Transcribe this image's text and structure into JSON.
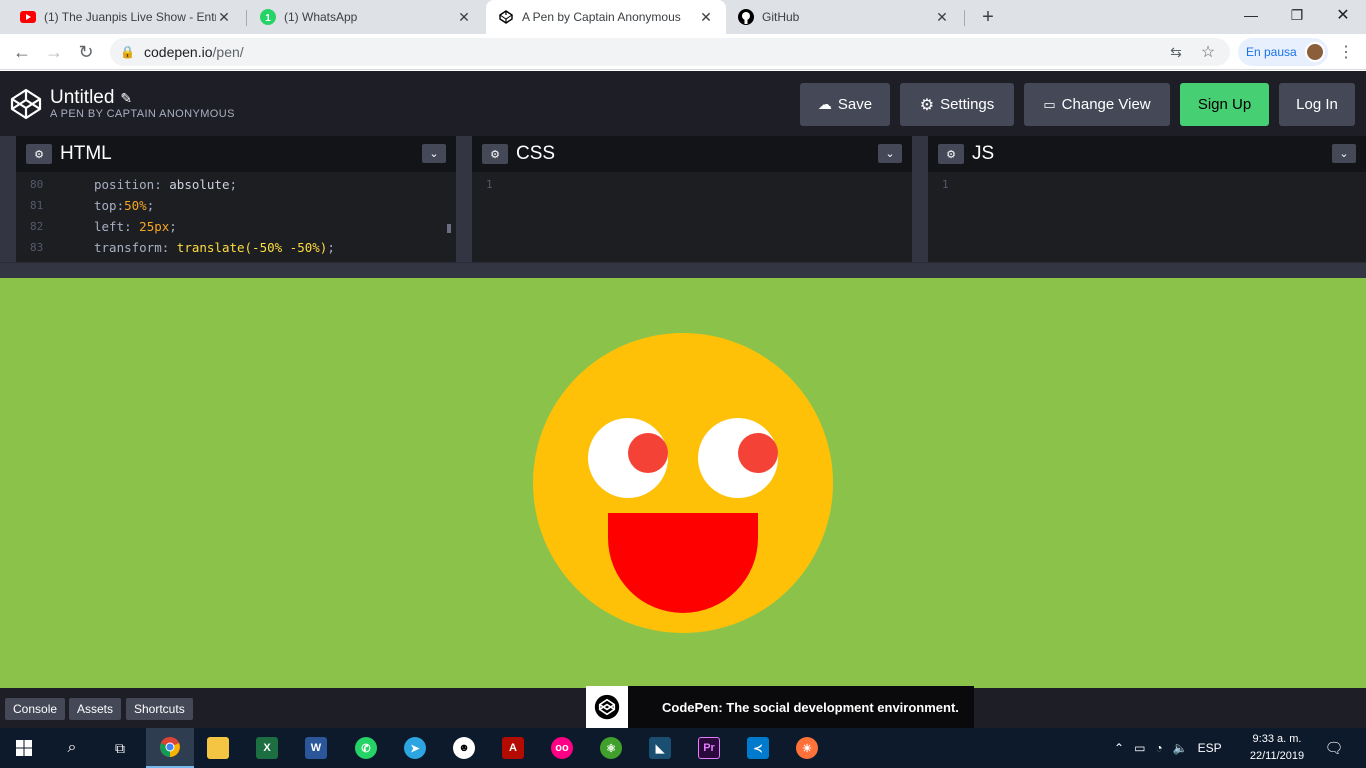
{
  "browser": {
    "tabs": [
      {
        "title": "(1) The Juanpis Live Show - Entre",
        "icon": "youtube-icon"
      },
      {
        "title": "(1) WhatsApp",
        "icon": "whatsapp-icon"
      },
      {
        "title": "A Pen by Captain Anonymous",
        "icon": "codepen-icon"
      },
      {
        "title": "GitHub",
        "icon": "github-icon"
      }
    ],
    "url_host": "codepen.io",
    "url_path": "/pen/",
    "profile_label": "En pausa"
  },
  "codepen": {
    "title": "Untitled",
    "subtitle": "A PEN BY CAPTAIN ANONYMOUS",
    "buttons": {
      "save": "Save",
      "settings": "Settings",
      "change_view": "Change View",
      "sign_up": "Sign Up",
      "log_in": "Log In"
    },
    "editors": {
      "html": {
        "label": "HTML",
        "lines": [
          {
            "num": "80",
            "prop": "position",
            "value": "absolute"
          },
          {
            "num": "81",
            "prop": "top",
            "value": "50%"
          },
          {
            "num": "82",
            "prop": "left",
            "value": "25px"
          },
          {
            "num": "83",
            "prop": "transform",
            "value": "translate(-50% -50%)"
          }
        ]
      },
      "css": {
        "label": "CSS",
        "line": "1"
      },
      "js": {
        "label": "JS",
        "line": "1"
      }
    },
    "footer": {
      "console": "Console",
      "assets": "Assets",
      "shortcuts": "Shortcuts"
    },
    "toast": "CodePen: The social development environment.",
    "colors": {
      "background": "#8bc34a",
      "face": "#ffc107",
      "pupil": "#f44336",
      "mouth": "#ff0000",
      "sign_up": "#47cf73"
    }
  },
  "taskbar": {
    "apps": [
      "start-icon",
      "search-icon",
      "task-view-icon",
      "chrome-icon",
      "file-explorer-icon",
      "excel-icon",
      "word-icon",
      "whatsapp-icon",
      "telegram-icon",
      "napster-icon",
      "acrobat-icon",
      "flickr-icon",
      "atom-icon",
      "mysql-workbench-icon",
      "premiere-icon",
      "vscode-icon",
      "firefox-icon"
    ],
    "language": "ESP",
    "time": "9:33 a. m.",
    "date": "22/11/2019"
  }
}
